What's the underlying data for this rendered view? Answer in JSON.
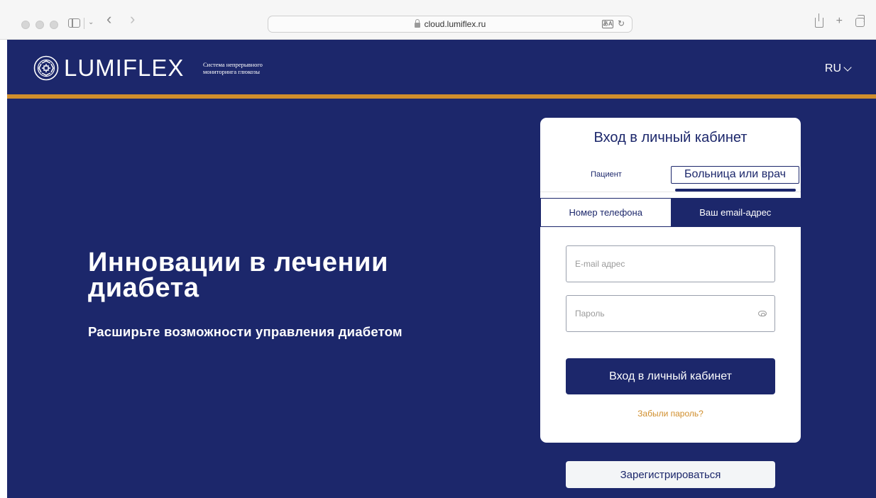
{
  "browser": {
    "url": "cloud.lumiflex.ru",
    "back_icon": "‹",
    "forward_icon": "›",
    "reload_icon": "↻",
    "translate_icon": "あA",
    "new_tab_icon": "+"
  },
  "header": {
    "logo_text": "LUMIFLEX",
    "logo_subtitle": "Система непрерывного мониторинга глюкозы",
    "language": "RU"
  },
  "hero": {
    "title": "Инновации в лечении диабета",
    "subtitle": "Расширьте возможности управления диабетом"
  },
  "login": {
    "title": "Вход в личный кабинет",
    "role_tabs": [
      "Пациент",
      "Больница или врач"
    ],
    "active_role": "Больница или врач",
    "method_tabs": [
      "Номер телефона",
      "Ваш email-адрес"
    ],
    "active_method": "Ваш email-адрес",
    "email_placeholder": "E-mail адрес",
    "password_placeholder": "Пароль",
    "submit_label": "Вход в личный кабинет",
    "forgot_label": "Забыли пароль?"
  },
  "register_label": "Зарегистрироваться",
  "colors": {
    "brand_navy": "#1c276b",
    "accent_orange": "#d08e2c",
    "card_bg": "#ffffff"
  }
}
